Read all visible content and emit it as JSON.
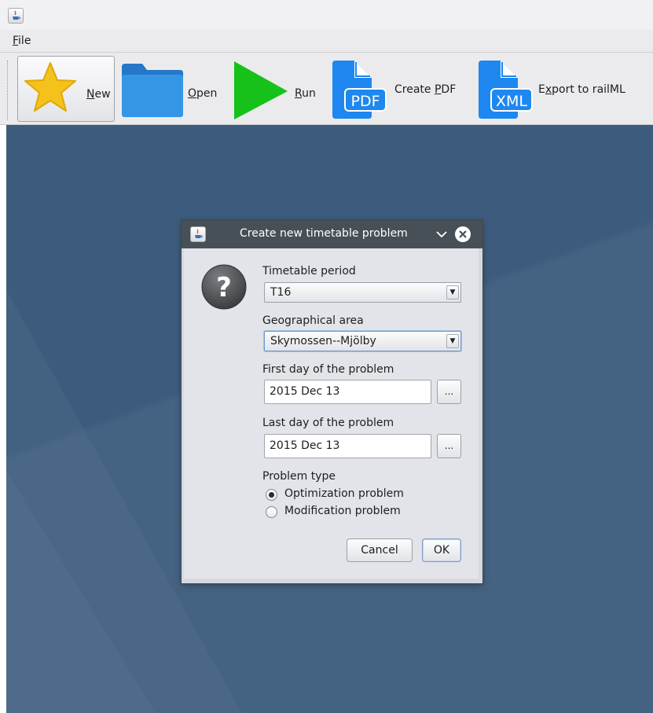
{
  "menubar": {
    "file_label_first": "F",
    "file_label_rest": "ile"
  },
  "toolbar": {
    "new": {
      "mnemonic": "N",
      "rest": "ew",
      "icon": "star-icon"
    },
    "open": {
      "mnemonic": "O",
      "rest": "pen",
      "icon": "folder-icon"
    },
    "run": {
      "mnemonic": "R",
      "rest": "un",
      "icon": "play-icon"
    },
    "create_pdf": {
      "prefix": "Create ",
      "mnemonic": "P",
      "rest": "DF",
      "icon": "pdf-file-icon",
      "icon_text": "PDF"
    },
    "export_railml": {
      "prefix": "E",
      "mnemonic": "x",
      "rest": "port to railML",
      "icon": "xml-file-icon",
      "icon_text": "XML"
    }
  },
  "colors": {
    "desktop": "#3d5c7d",
    "dialog_titlebar": "#475057",
    "star": "#f5c21b",
    "folder": "#2f8fe0",
    "play": "#16c21a",
    "file_icon": "#1e88f0"
  },
  "dialog": {
    "title": "Create new timetable problem",
    "timetable_period_label": "Timetable period",
    "timetable_period_value": "T16",
    "geo_area_label": "Geographical area",
    "geo_area_value": "Skymossen--Mjölby",
    "first_day_label": "First day of the problem",
    "first_day_value": "2015 Dec 13",
    "last_day_label": "Last day of the problem",
    "last_day_value": "2015 Dec 13",
    "picker_button": "...",
    "problem_type_label": "Problem type",
    "options": [
      {
        "label": "Optimization problem",
        "selected": true
      },
      {
        "label": "Modification problem",
        "selected": false
      }
    ],
    "cancel": "Cancel",
    "ok": "OK"
  }
}
